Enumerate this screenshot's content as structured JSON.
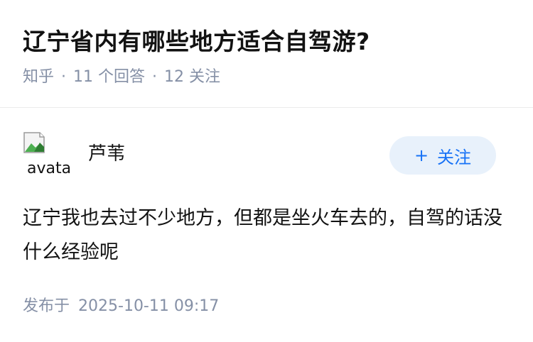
{
  "question": {
    "title": "辽宁省内有哪些地方适合自驾游?",
    "source": "知乎",
    "answer_count": "11 个回答",
    "follower_count": "12 关注"
  },
  "answer": {
    "avatar_alt": "avatar",
    "author": "芦苇",
    "follow_label": "关注",
    "content": "辽宁我也去过不少地方，但都是坐火车去的，自驾的话没什么经验呢",
    "publish_label": "发布于",
    "publish_time": "2025-10-11 09:17"
  },
  "colors": {
    "accent": "#1772f6",
    "follow_bg": "#e8f1fb",
    "meta_text": "#8590a6"
  }
}
